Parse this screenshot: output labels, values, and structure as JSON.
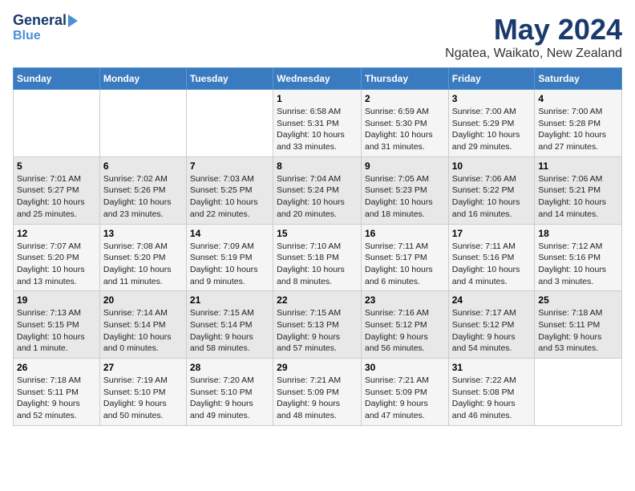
{
  "header": {
    "logo_line1": "General",
    "logo_line2": "Blue",
    "month": "May 2024",
    "location": "Ngatea, Waikato, New Zealand"
  },
  "days_of_week": [
    "Sunday",
    "Monday",
    "Tuesday",
    "Wednesday",
    "Thursday",
    "Friday",
    "Saturday"
  ],
  "weeks": [
    [
      {
        "day": "",
        "content": ""
      },
      {
        "day": "",
        "content": ""
      },
      {
        "day": "",
        "content": ""
      },
      {
        "day": "1",
        "content": "Sunrise: 6:58 AM\nSunset: 5:31 PM\nDaylight: 10 hours\nand 33 minutes."
      },
      {
        "day": "2",
        "content": "Sunrise: 6:59 AM\nSunset: 5:30 PM\nDaylight: 10 hours\nand 31 minutes."
      },
      {
        "day": "3",
        "content": "Sunrise: 7:00 AM\nSunset: 5:29 PM\nDaylight: 10 hours\nand 29 minutes."
      },
      {
        "day": "4",
        "content": "Sunrise: 7:00 AM\nSunset: 5:28 PM\nDaylight: 10 hours\nand 27 minutes."
      }
    ],
    [
      {
        "day": "5",
        "content": "Sunrise: 7:01 AM\nSunset: 5:27 PM\nDaylight: 10 hours\nand 25 minutes."
      },
      {
        "day": "6",
        "content": "Sunrise: 7:02 AM\nSunset: 5:26 PM\nDaylight: 10 hours\nand 23 minutes."
      },
      {
        "day": "7",
        "content": "Sunrise: 7:03 AM\nSunset: 5:25 PM\nDaylight: 10 hours\nand 22 minutes."
      },
      {
        "day": "8",
        "content": "Sunrise: 7:04 AM\nSunset: 5:24 PM\nDaylight: 10 hours\nand 20 minutes."
      },
      {
        "day": "9",
        "content": "Sunrise: 7:05 AM\nSunset: 5:23 PM\nDaylight: 10 hours\nand 18 minutes."
      },
      {
        "day": "10",
        "content": "Sunrise: 7:06 AM\nSunset: 5:22 PM\nDaylight: 10 hours\nand 16 minutes."
      },
      {
        "day": "11",
        "content": "Sunrise: 7:06 AM\nSunset: 5:21 PM\nDaylight: 10 hours\nand 14 minutes."
      }
    ],
    [
      {
        "day": "12",
        "content": "Sunrise: 7:07 AM\nSunset: 5:20 PM\nDaylight: 10 hours\nand 13 minutes."
      },
      {
        "day": "13",
        "content": "Sunrise: 7:08 AM\nSunset: 5:20 PM\nDaylight: 10 hours\nand 11 minutes."
      },
      {
        "day": "14",
        "content": "Sunrise: 7:09 AM\nSunset: 5:19 PM\nDaylight: 10 hours\nand 9 minutes."
      },
      {
        "day": "15",
        "content": "Sunrise: 7:10 AM\nSunset: 5:18 PM\nDaylight: 10 hours\nand 8 minutes."
      },
      {
        "day": "16",
        "content": "Sunrise: 7:11 AM\nSunset: 5:17 PM\nDaylight: 10 hours\nand 6 minutes."
      },
      {
        "day": "17",
        "content": "Sunrise: 7:11 AM\nSunset: 5:16 PM\nDaylight: 10 hours\nand 4 minutes."
      },
      {
        "day": "18",
        "content": "Sunrise: 7:12 AM\nSunset: 5:16 PM\nDaylight: 10 hours\nand 3 minutes."
      }
    ],
    [
      {
        "day": "19",
        "content": "Sunrise: 7:13 AM\nSunset: 5:15 PM\nDaylight: 10 hours\nand 1 minute."
      },
      {
        "day": "20",
        "content": "Sunrise: 7:14 AM\nSunset: 5:14 PM\nDaylight: 10 hours\nand 0 minutes."
      },
      {
        "day": "21",
        "content": "Sunrise: 7:15 AM\nSunset: 5:14 PM\nDaylight: 9 hours\nand 58 minutes."
      },
      {
        "day": "22",
        "content": "Sunrise: 7:15 AM\nSunset: 5:13 PM\nDaylight: 9 hours\nand 57 minutes."
      },
      {
        "day": "23",
        "content": "Sunrise: 7:16 AM\nSunset: 5:12 PM\nDaylight: 9 hours\nand 56 minutes."
      },
      {
        "day": "24",
        "content": "Sunrise: 7:17 AM\nSunset: 5:12 PM\nDaylight: 9 hours\nand 54 minutes."
      },
      {
        "day": "25",
        "content": "Sunrise: 7:18 AM\nSunset: 5:11 PM\nDaylight: 9 hours\nand 53 minutes."
      }
    ],
    [
      {
        "day": "26",
        "content": "Sunrise: 7:18 AM\nSunset: 5:11 PM\nDaylight: 9 hours\nand 52 minutes."
      },
      {
        "day": "27",
        "content": "Sunrise: 7:19 AM\nSunset: 5:10 PM\nDaylight: 9 hours\nand 50 minutes."
      },
      {
        "day": "28",
        "content": "Sunrise: 7:20 AM\nSunset: 5:10 PM\nDaylight: 9 hours\nand 49 minutes."
      },
      {
        "day": "29",
        "content": "Sunrise: 7:21 AM\nSunset: 5:09 PM\nDaylight: 9 hours\nand 48 minutes."
      },
      {
        "day": "30",
        "content": "Sunrise: 7:21 AM\nSunset: 5:09 PM\nDaylight: 9 hours\nand 47 minutes."
      },
      {
        "day": "31",
        "content": "Sunrise: 7:22 AM\nSunset: 5:08 PM\nDaylight: 9 hours\nand 46 minutes."
      },
      {
        "day": "",
        "content": ""
      }
    ]
  ]
}
